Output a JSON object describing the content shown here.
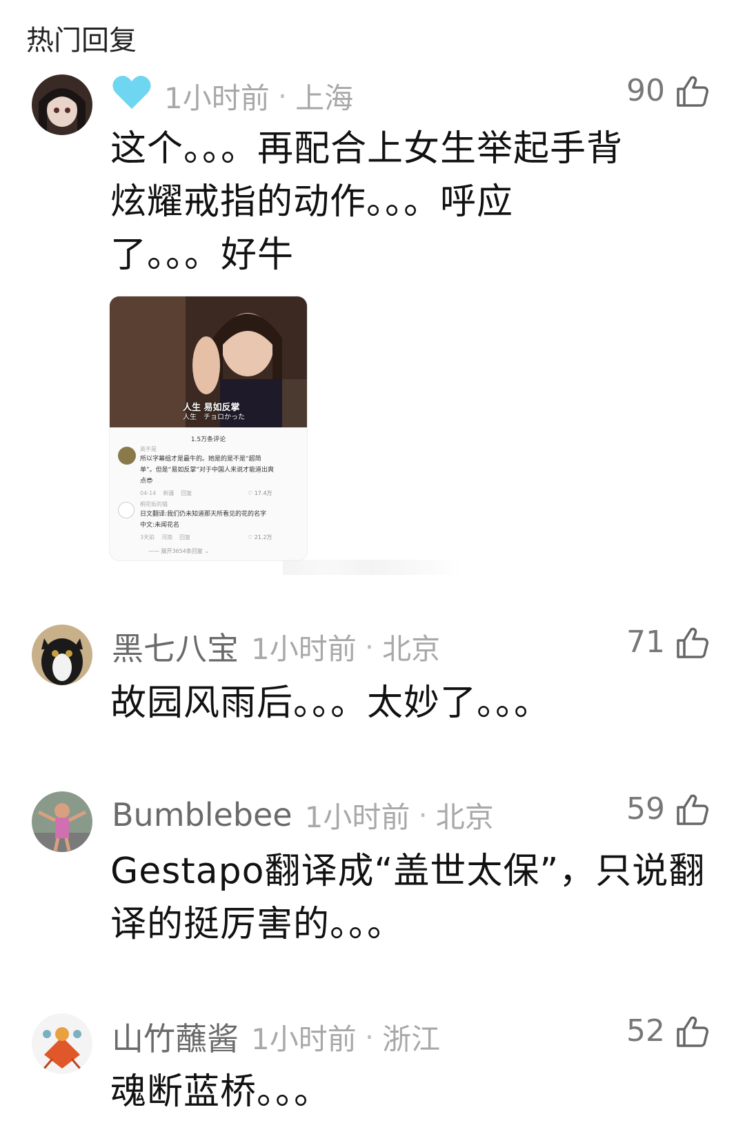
{
  "section_title": "热门回复",
  "comments": [
    {
      "name": "",
      "badge_icon": "heart-icon",
      "badge_color": "#6fd6f2",
      "time": "1小时前",
      "separator": "·",
      "location": "上海",
      "likes": "90",
      "lines": [
        "这个。。。再配合上女生举起手背",
        "炫耀戒指的动作。。。呼应",
        "了。。。好牛"
      ],
      "embed": {
        "subtitle_cn": "人生 易如反掌",
        "subtitle_jp": "人生　チョロかった",
        "count": "1.5万条评论",
        "c1_name": "英不是",
        "c1_lines": [
          "所以字幕组才是最牛的。她是的是不是“超简",
          "单”。但是“易如反掌”对于中国人来说才能道出爽",
          "点😎"
        ],
        "c1_date": "04-14",
        "c1_loc": "新疆",
        "c1_reply": "回复",
        "c1_likes": "17.4万",
        "c2_name": "桐花街的猫",
        "c2_lines": [
          "日文翻译:我们仍未知道那天所看见的花的名字",
          "中文:未闻花名"
        ],
        "c2_date": "3天前",
        "c2_loc": "河南",
        "c2_reply": "回复",
        "c2_likes": "21.2万",
        "expand": "—— 展开3654条回复 ⌄"
      }
    },
    {
      "name": "黑七八宝",
      "time": "1小时前",
      "separator": "·",
      "location": "北京",
      "likes": "71",
      "lines": [
        "故园风雨后。。。太妙了。。。"
      ]
    },
    {
      "name": "Bumblebee",
      "time": "1小时前",
      "separator": "·",
      "location": "北京",
      "likes": "59",
      "lines": [
        "Gestapo翻译成“盖世太保”，只说翻",
        "译的挺厉害的。。。"
      ]
    },
    {
      "name": "山竹蘸酱",
      "time": "1小时前",
      "separator": "·",
      "location": "浙江",
      "likes": "52",
      "lines": [
        "魂断蓝桥。。。"
      ]
    }
  ]
}
